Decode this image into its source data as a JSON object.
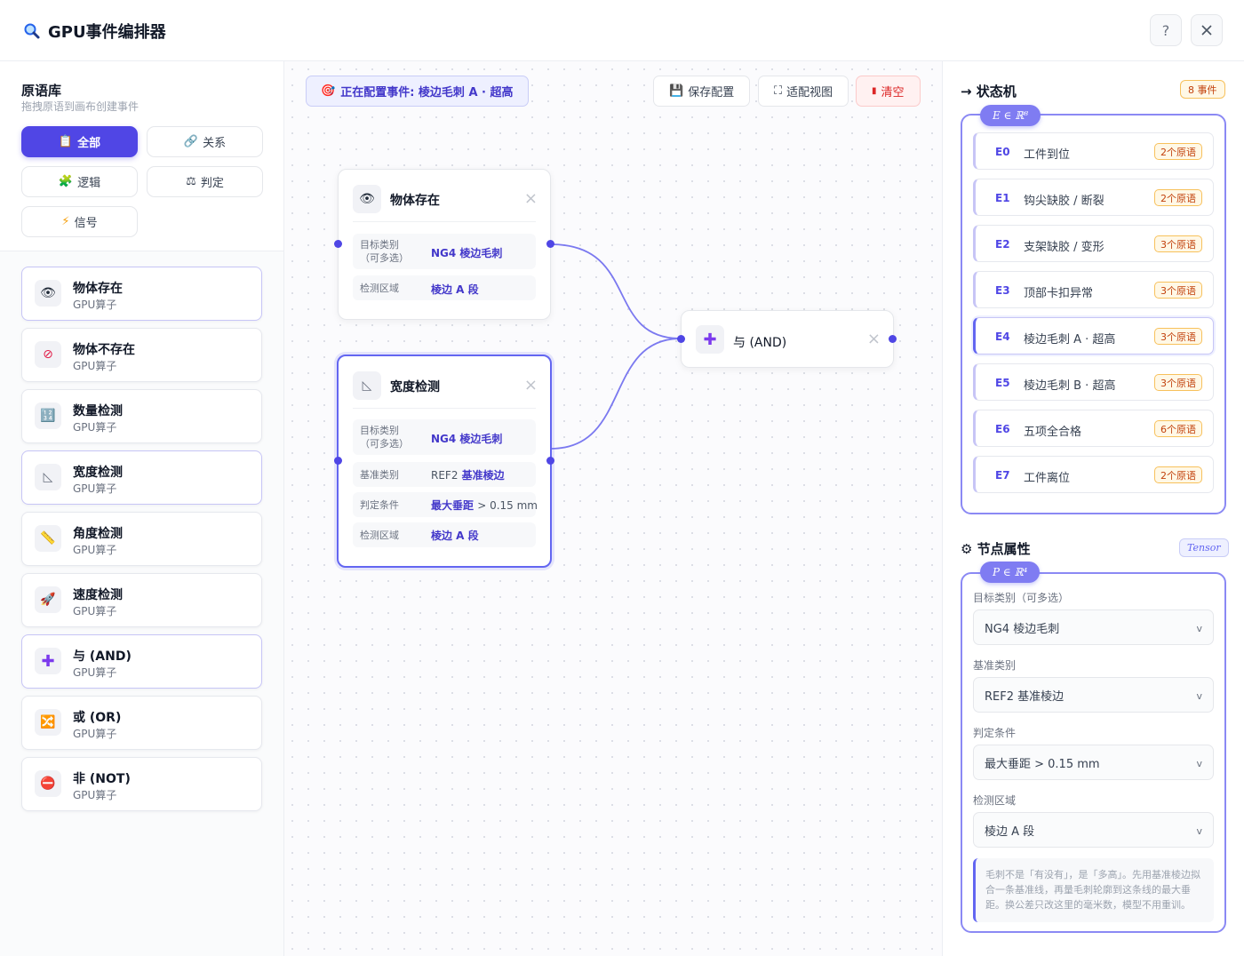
{
  "app": {
    "title": "GPU事件编排器",
    "help": "?",
    "close": "✕"
  },
  "library": {
    "title": "原语库",
    "subtitle": "拖拽原语到画布创建事件",
    "filters": [
      {
        "icon": "📋",
        "label": "全部"
      },
      {
        "icon": "🔗",
        "label": "关系"
      },
      {
        "icon": "🧩",
        "label": "逻辑"
      },
      {
        "icon": "⚖",
        "label": "判定"
      },
      {
        "icon": "⚡",
        "label": "信号"
      }
    ],
    "primitives": [
      {
        "icon": "👁",
        "name": "物体存在",
        "sub": "GPU算子"
      },
      {
        "icon": "⊘",
        "name": "物体不存在",
        "sub": "GPU算子"
      },
      {
        "icon": "🔢",
        "name": "数量检测",
        "sub": "GPU算子"
      },
      {
        "icon": "◺",
        "name": "宽度检测",
        "sub": "GPU算子"
      },
      {
        "icon": "📏",
        "name": "角度检测",
        "sub": "GPU算子"
      },
      {
        "icon": "🚀",
        "name": "速度检测",
        "sub": "GPU算子"
      },
      {
        "icon": "✚",
        "name": "与 (AND)",
        "sub": "GPU算子"
      },
      {
        "icon": "🔀",
        "name": "或 (OR)",
        "sub": "GPU算子"
      },
      {
        "icon": "⛔",
        "name": "非 (NOT)",
        "sub": "GPU算子"
      }
    ]
  },
  "canvas": {
    "config_tag": "正在配置事件: 棱边毛刺 A · 超高",
    "toolbar": {
      "save": "保存配置",
      "fit": "适配视图",
      "clear": "清空"
    },
    "nodes": {
      "exist": {
        "title": "物体存在",
        "rows": [
          {
            "key": "目标类别\n（可多选）",
            "value": "NG4 棱边毛刺"
          },
          {
            "key": "检测区域",
            "value": "棱边 A 段"
          }
        ]
      },
      "width": {
        "title": "宽度检测",
        "rows": [
          {
            "key": "目标类别\n（可多选）",
            "value": "NG4 棱边毛刺"
          },
          {
            "key": "基准类别",
            "value_a": "REF2",
            "value_b": "基准棱边"
          },
          {
            "key": "判定条件",
            "value_a": "最大垂距",
            "value_b": "> 0.15 mm"
          },
          {
            "key": "检测区域",
            "value": "棱边 A 段"
          }
        ]
      },
      "and": {
        "title": "与 (AND)"
      }
    }
  },
  "state_machine": {
    "title": "→ 状态机",
    "count_badge": "8 事件",
    "math": "E ∈ ℝ⁸",
    "events": [
      {
        "id": "E0",
        "name": "工件到位",
        "count": "2个原语"
      },
      {
        "id": "E1",
        "name": "钩尖缺胶 / 断裂",
        "count": "2个原语"
      },
      {
        "id": "E2",
        "name": "支架缺胶 / 变形",
        "count": "3个原语"
      },
      {
        "id": "E3",
        "name": "顶部卡扣异常",
        "count": "3个原语"
      },
      {
        "id": "E4",
        "name": "棱边毛刺 A · 超高",
        "count": "3个原语"
      },
      {
        "id": "E5",
        "name": "棱边毛刺 B · 超高",
        "count": "3个原语"
      },
      {
        "id": "E6",
        "name": "五项全合格",
        "count": "6个原语"
      },
      {
        "id": "E7",
        "name": "工件离位",
        "count": "2个原语"
      }
    ]
  },
  "props": {
    "title": "⚙ 节点属性",
    "badge": "Tensor",
    "math": "P ∈ ℝ⁴",
    "fields": [
      {
        "label": "目标类别（可多选）",
        "value": "NG4 棱边毛刺"
      },
      {
        "label": "基准类别",
        "value": "REF2 基准棱边"
      },
      {
        "label": "判定条件",
        "value": "最大垂距 > 0.15 mm"
      },
      {
        "label": "检测区域",
        "value": "棱边 A 段"
      }
    ],
    "note": "毛刺不是「有没有」，是「多高」。先用基准棱边拟合一条基准线，再量毛刺轮廓到这条线的最大垂距。换公差只改这里的毫米数，模型不用重训。"
  },
  "colors": {
    "accent": "#5046e5",
    "wire": "#7b79f0",
    "badge": "#f7c15c"
  }
}
